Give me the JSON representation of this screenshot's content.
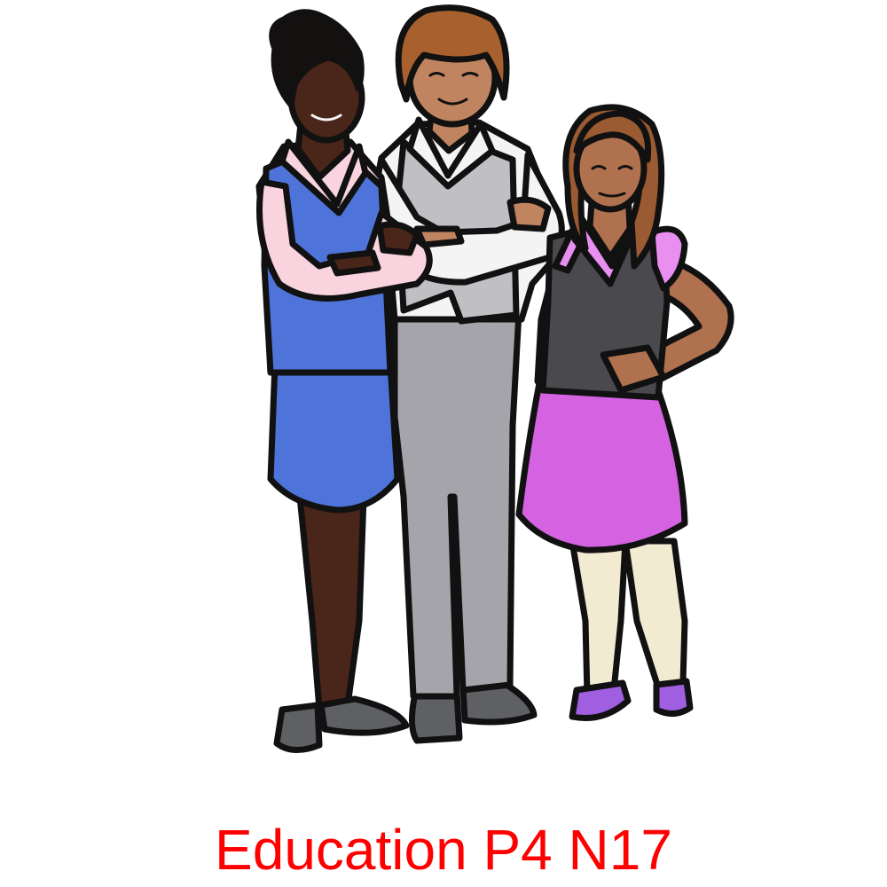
{
  "caption": "Education P4 N17",
  "colors": {
    "caption": "#ff0000",
    "outline": "#111111",
    "skin_dark": "#4a2519",
    "skin_medium": "#c08560",
    "skin_tan": "#b0714f",
    "hair_black": "#141010",
    "hair_brown": "#a8612e",
    "hair_auburn": "#9a5a32",
    "blue_uniform": "#4f74d9",
    "pink_blouse": "#f9d3de",
    "grey_vest": "#c0c0c4",
    "grey_trousers": "#a4a4aa",
    "white_shirt": "#f4f4f4",
    "dark_vest": "#4a4a4e",
    "purple_skirt": "#d563e1",
    "purple_sleeve": "#e88ff0",
    "cream_tights": "#f2ebd2",
    "dark_shoe": "#5f6064",
    "purple_shoe": "#a05fe0"
  },
  "figures": [
    {
      "name": "girl-blue-uniform",
      "pose": "arms folded"
    },
    {
      "name": "boy-grey-uniform",
      "pose": "arms folded"
    },
    {
      "name": "girl-purple-skirt",
      "pose": "hand on hip"
    }
  ]
}
